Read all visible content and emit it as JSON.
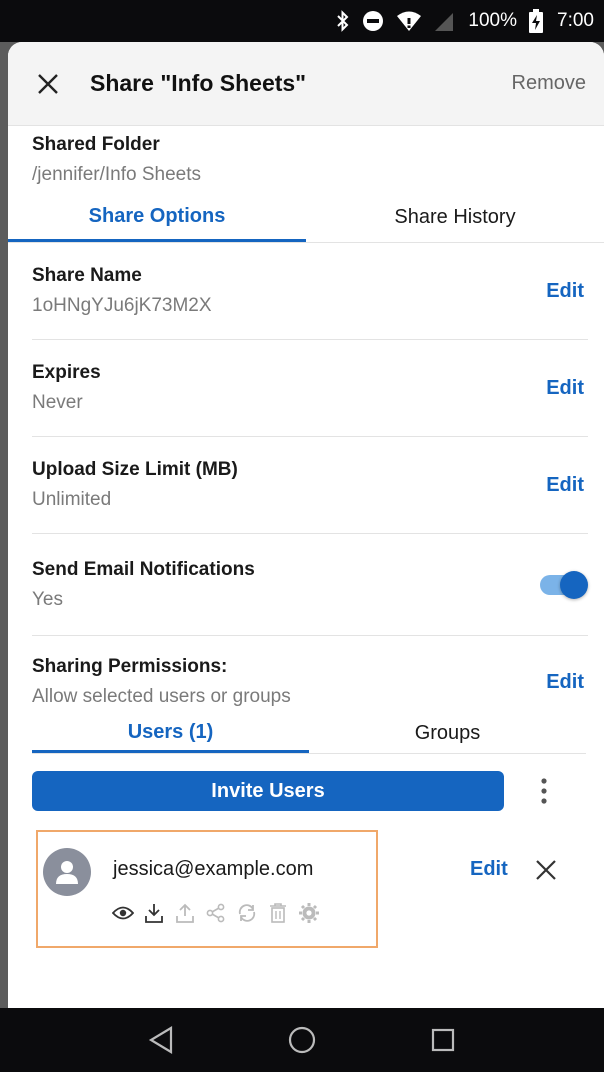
{
  "status_bar": {
    "battery": "100%",
    "time": "7:00",
    "icons": [
      "bluetooth-icon",
      "do-not-disturb-icon",
      "wifi-icon",
      "signal-icon",
      "battery-charging-icon"
    ]
  },
  "header": {
    "title": "Share \"Info Sheets\"",
    "remove_label": "Remove"
  },
  "folder": {
    "label": "Shared Folder",
    "path": "/jennifer/Info Sheets"
  },
  "tabs": [
    {
      "label": "Share Options",
      "active": true
    },
    {
      "label": "Share History",
      "active": false
    }
  ],
  "options": {
    "share_name": {
      "label": "Share Name",
      "value": "1oHNgYJu6jK73M2X",
      "action": "Edit"
    },
    "expires": {
      "label": "Expires",
      "value": "Never",
      "action": "Edit"
    },
    "upload_limit": {
      "label": "Upload Size Limit (MB)",
      "value": "Unlimited",
      "action": "Edit"
    },
    "email_notifications": {
      "label": "Send Email Notifications",
      "value": "Yes",
      "toggle_on": true
    },
    "permissions": {
      "label": "Sharing Permissions:",
      "value": "Allow selected users or groups",
      "action": "Edit"
    }
  },
  "subtabs": [
    {
      "label": "Users (1)",
      "active": true
    },
    {
      "label": "Groups",
      "active": false
    }
  ],
  "invite": {
    "button_label": "Invite Users"
  },
  "user": {
    "email": "jessica@example.com",
    "edit_label": "Edit",
    "permission_icons": [
      "view-icon",
      "download-icon",
      "upload-icon",
      "share-icon",
      "sync-icon",
      "delete-icon",
      "manage-icon"
    ]
  },
  "colors": {
    "accent": "#1565c0",
    "highlight_border": "#f0a86a"
  }
}
